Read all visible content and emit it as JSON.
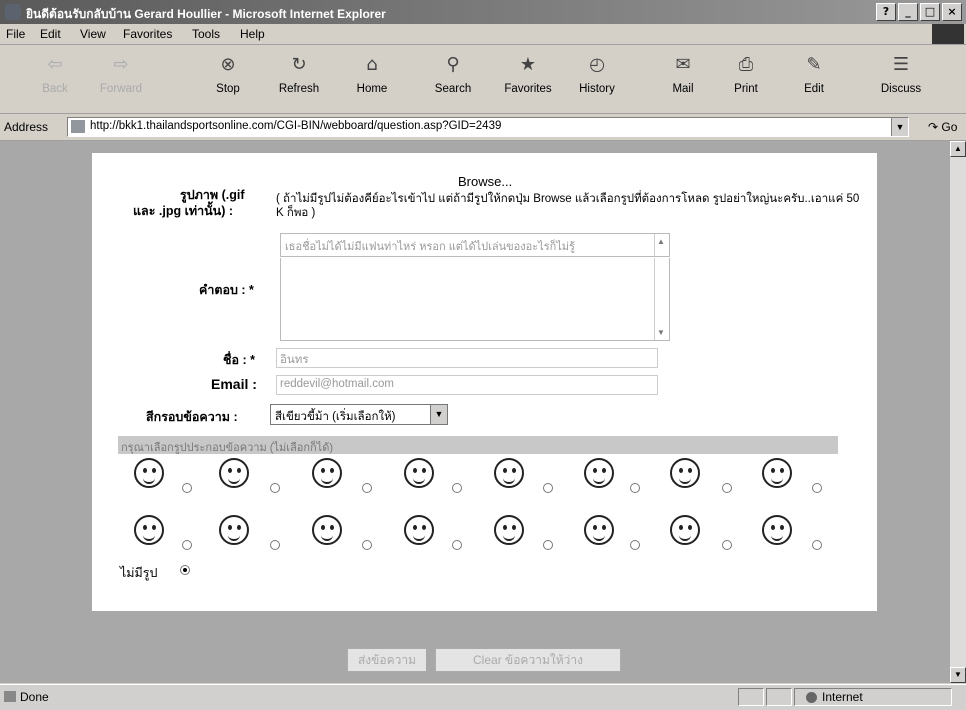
{
  "window": {
    "title": "ยินดีต้อนรับกลับบ้าน Gerard Houllier - Microsoft Internet Explorer",
    "controls": {
      "help": "?",
      "minimize": "_",
      "maximize": "□",
      "close": "×"
    }
  },
  "menu": [
    "File",
    "Edit",
    "View",
    "Favorites",
    "Tools",
    "Help"
  ],
  "toolbar": [
    {
      "label": "Back",
      "icon": "back-arrow-icon",
      "glyph": "⇦",
      "disabled": true
    },
    {
      "label": "Forward",
      "icon": "forward-arrow-icon",
      "glyph": "⇨",
      "disabled": true
    },
    {
      "label": "Stop",
      "icon": "stop-icon",
      "glyph": "⊗"
    },
    {
      "label": "Refresh",
      "icon": "refresh-icon",
      "glyph": "↻"
    },
    {
      "label": "Home",
      "icon": "home-icon",
      "glyph": "⌂"
    },
    {
      "label": "Search",
      "icon": "search-icon",
      "glyph": "⚲"
    },
    {
      "label": "Favorites",
      "icon": "favorites-icon",
      "glyph": "★"
    },
    {
      "label": "History",
      "icon": "history-icon",
      "glyph": "◴"
    },
    {
      "label": "Mail",
      "icon": "mail-icon",
      "glyph": "✉"
    },
    {
      "label": "Print",
      "icon": "print-icon",
      "glyph": "⎙"
    },
    {
      "label": "Edit",
      "icon": "edit-icon",
      "glyph": "✎"
    },
    {
      "label": "Discuss",
      "icon": "discuss-icon",
      "glyph": "☰"
    }
  ],
  "address": {
    "label": "Address",
    "url": "http://bkk1.thailandsportsonline.com/CGI-BIN/webboard/question.asp?GID=2439",
    "go": "Go"
  },
  "form": {
    "image_label_1": "รูปภาพ (.gif",
    "image_label_2": "และ .jpg เท่านั้น) :",
    "browse": "Browse...",
    "image_hint": "( ถ้าไม่มีรูปไม่ต้องคีย์อะไรเข้าไป แต่ถ้ามีรูปให้กดปุ่ม Browse แล้วเลือกรูปที่ต้องการโหลด รูปอย่าใหญ่นะครับ..เอาแค่ 50 K ก็พอ )",
    "answer_label": "คำตอบ : *",
    "answer_text": "เธอชื่อไม่ได้ไม่มีแฟนท่าไหร่ หรอก แต่ได้ไปเล่นของอะไรก็ไม่รู้",
    "name_label": "ชื่อ : *",
    "name_value": "อินทร",
    "email_label": "Email :",
    "email_value": "reddevil@hotmail.com",
    "frame_label": "สีกรอบข้อความ :",
    "frame_value": "สีเขียวขี้ม้า (เริ่มเลือกให้)",
    "icon_bar_text": "กรุณาเลือกรูปประกอบข้อความ (ไม่เลือกก็ได้)",
    "no_picture": "ไม่มีรูป",
    "submit": "ส่งข้อความ",
    "clear": "Clear ข้อความให้ว่าง"
  },
  "status": {
    "left": "Done",
    "zone": "Internet"
  }
}
